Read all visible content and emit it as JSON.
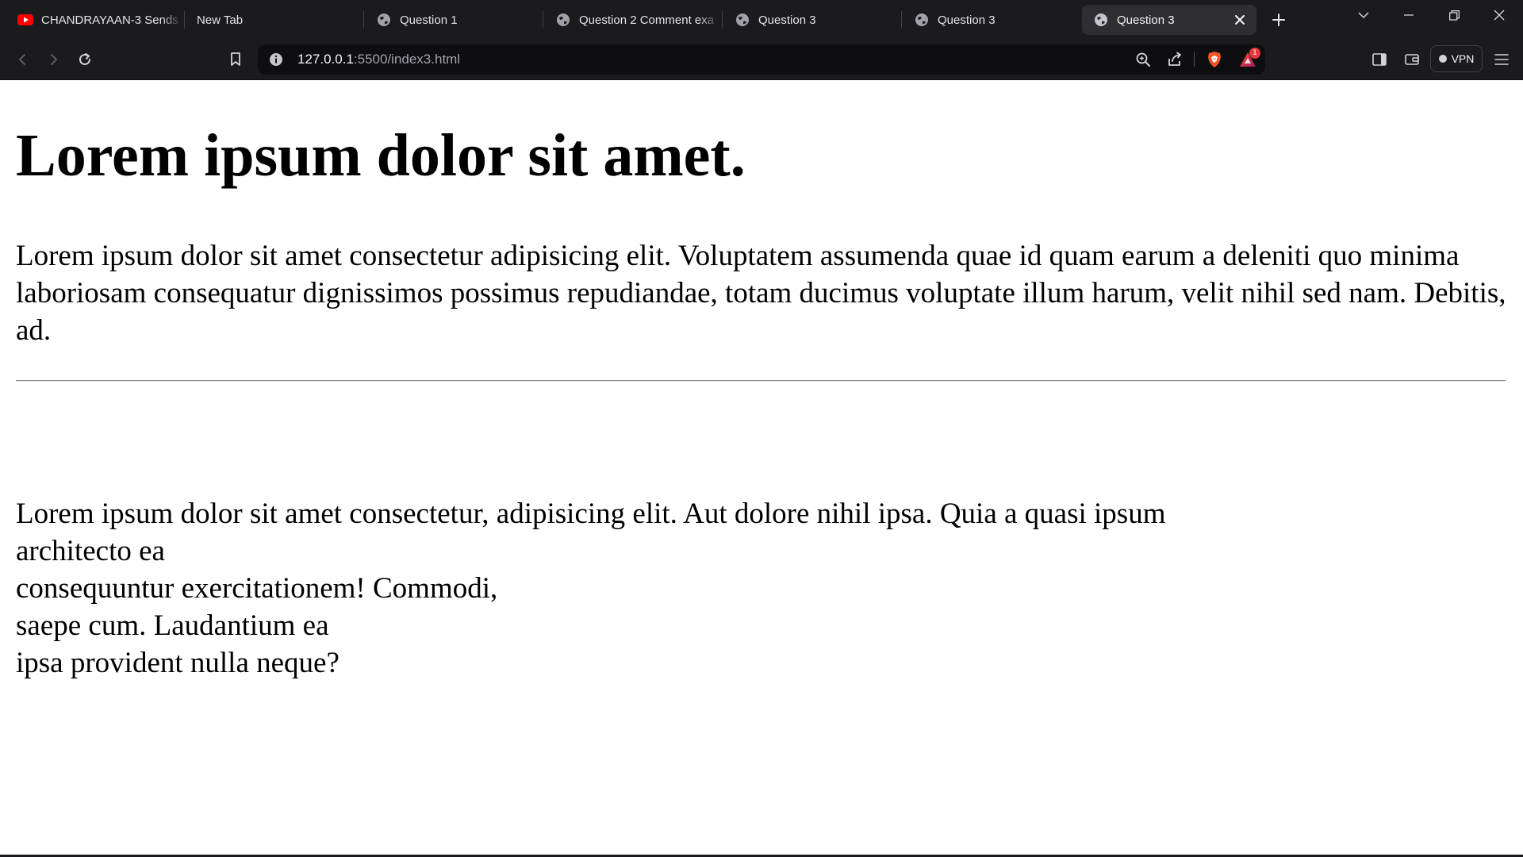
{
  "tabs": [
    {
      "title": "CHANDRAYAAN-3 Sends",
      "icon": "youtube-icon",
      "active": false
    },
    {
      "title": "New Tab",
      "icon": "",
      "active": false
    },
    {
      "title": "Question 1",
      "icon": "globe-icon",
      "active": false
    },
    {
      "title": "Question 2 Comment exa",
      "icon": "globe-icon",
      "active": false
    },
    {
      "title": "Question 3",
      "icon": "globe-icon",
      "active": false
    },
    {
      "title": "Question 3",
      "icon": "globe-icon",
      "active": false
    },
    {
      "title": "Question 3",
      "icon": "globe-icon",
      "active": true
    }
  ],
  "address": {
    "host": "127.0.0.1",
    "path": ":5500/index3.html"
  },
  "toolbar": {
    "notification_count": "1",
    "vpn_label": "VPN"
  },
  "colors": {
    "chrome_bg": "#1b1b1e",
    "urlbar_bg": "#0e0e10",
    "active_tab_bg": "#2e2e33",
    "brave_orange": "#fb542b",
    "badge_red": "#e5383b"
  },
  "page": {
    "heading": "Lorem ipsum dolor sit amet.",
    "paragraph1": "Lorem ipsum dolor sit amet consectetur adipisicing elit. Voluptatem assumenda quae id quam earum a deleniti quo minima laboriosam consequatur dignissimos possimus repudiandae, totam ducimus voluptate illum harum, velit nihil sed nam. Debitis, ad.",
    "paragraph2_lines": [
      "Lorem ipsum dolor sit amet consectetur, adipisicing elit. Aut dolore nihil ipsa. Quia a quasi ipsum",
      "architecto ea",
      "consequuntur exercitationem! Commodi,",
      "saepe cum. Laudantium ea",
      "ipsa provident nulla neque?"
    ]
  }
}
